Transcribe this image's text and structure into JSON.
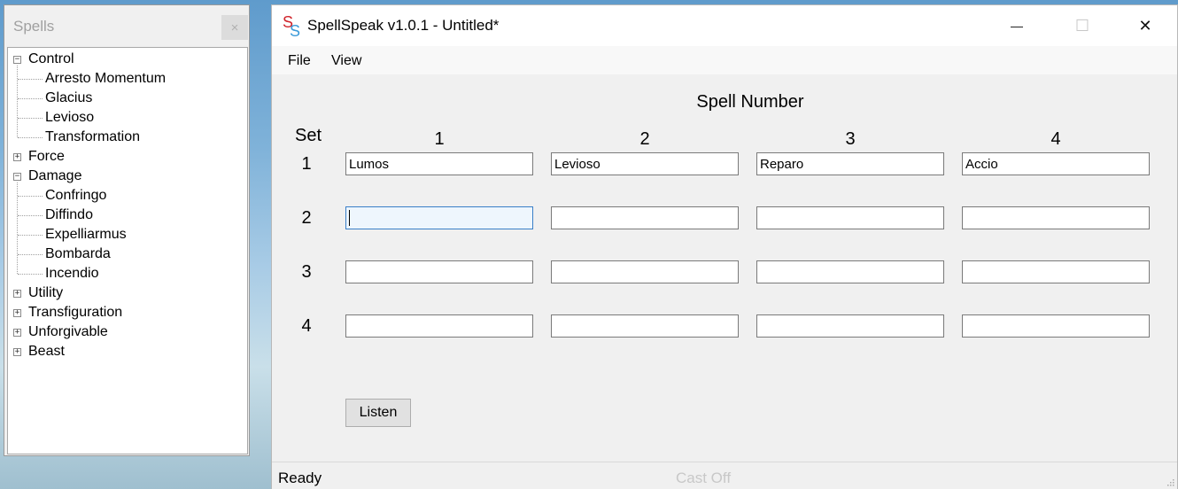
{
  "spells_panel": {
    "title": "Spells",
    "close_label": "×",
    "tree": [
      {
        "label": "Control",
        "expanded": true,
        "children": [
          "Arresto Momentum",
          "Glacius",
          "Levioso",
          "Transformation"
        ]
      },
      {
        "label": "Force",
        "expanded": false
      },
      {
        "label": "Damage",
        "expanded": true,
        "children": [
          "Confringo",
          "Diffindo",
          "Expelliarmus",
          "Bombarda",
          "Incendio"
        ]
      },
      {
        "label": "Utility",
        "expanded": false
      },
      {
        "label": "Transfiguration",
        "expanded": false
      },
      {
        "label": "Unforgivable",
        "expanded": false
      },
      {
        "label": "Beast",
        "expanded": false
      }
    ]
  },
  "window": {
    "title": "SpellSpeak v1.0.1 - Untitled*",
    "logo_letters": "SS",
    "minimize": "—",
    "maximize": "☐",
    "close": "✕"
  },
  "menu": [
    "File",
    "View"
  ],
  "grid": {
    "heading": "Spell Number",
    "set_label": "Set",
    "columns": [
      "1",
      "2",
      "3",
      "4"
    ],
    "rows": [
      {
        "label": "1",
        "values": [
          "Lumos",
          "Levioso",
          "Reparo",
          "Accio"
        ]
      },
      {
        "label": "2",
        "values": [
          "",
          "",
          "",
          ""
        ]
      },
      {
        "label": "3",
        "values": [
          "",
          "",
          "",
          ""
        ]
      },
      {
        "label": "4",
        "values": [
          "",
          "",
          "",
          ""
        ]
      }
    ]
  },
  "listen_label": "Listen",
  "status": {
    "text": "Ready",
    "cast": "Cast Off"
  },
  "colors": {
    "logo_red": "#d0242b",
    "logo_blue": "#3a9ad9",
    "focus_border": "#3a7fc8"
  }
}
